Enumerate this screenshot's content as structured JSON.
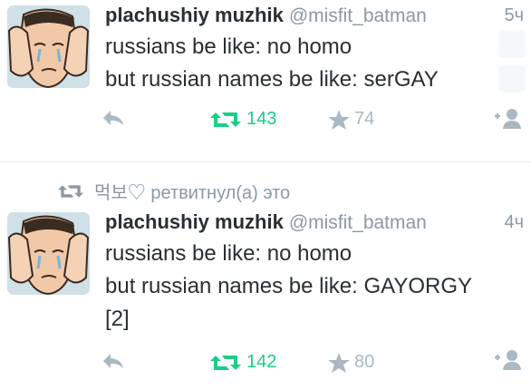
{
  "tweets": [
    {
      "display_name": "plachushiy muzhik",
      "handle": "@misfit_batman",
      "time": "5ч",
      "lines": [
        "russians be like: no homo",
        "but russian names be like: serGAY"
      ],
      "retweets": "143",
      "likes": "74"
    },
    {
      "display_name": "plachushiy muzhik",
      "handle": "@misfit_batman",
      "time": "4ч",
      "lines": [
        "russians be like: no homo",
        "but russian names be like: GAYORGY",
        "[2]"
      ],
      "retweets": "142",
      "likes": "80"
    }
  ],
  "retweet_context": "먹보♡ ретвитнул(а) это",
  "icons": {
    "reply": "reply-arrow-icon",
    "retweet": "retweet-icon",
    "like": "star-icon",
    "follow": "follow-user-icon"
  },
  "colors": {
    "retweet_active": "#19cf86",
    "muted": "#aab8c2",
    "text": "#292f33",
    "handle": "#8899a6"
  }
}
